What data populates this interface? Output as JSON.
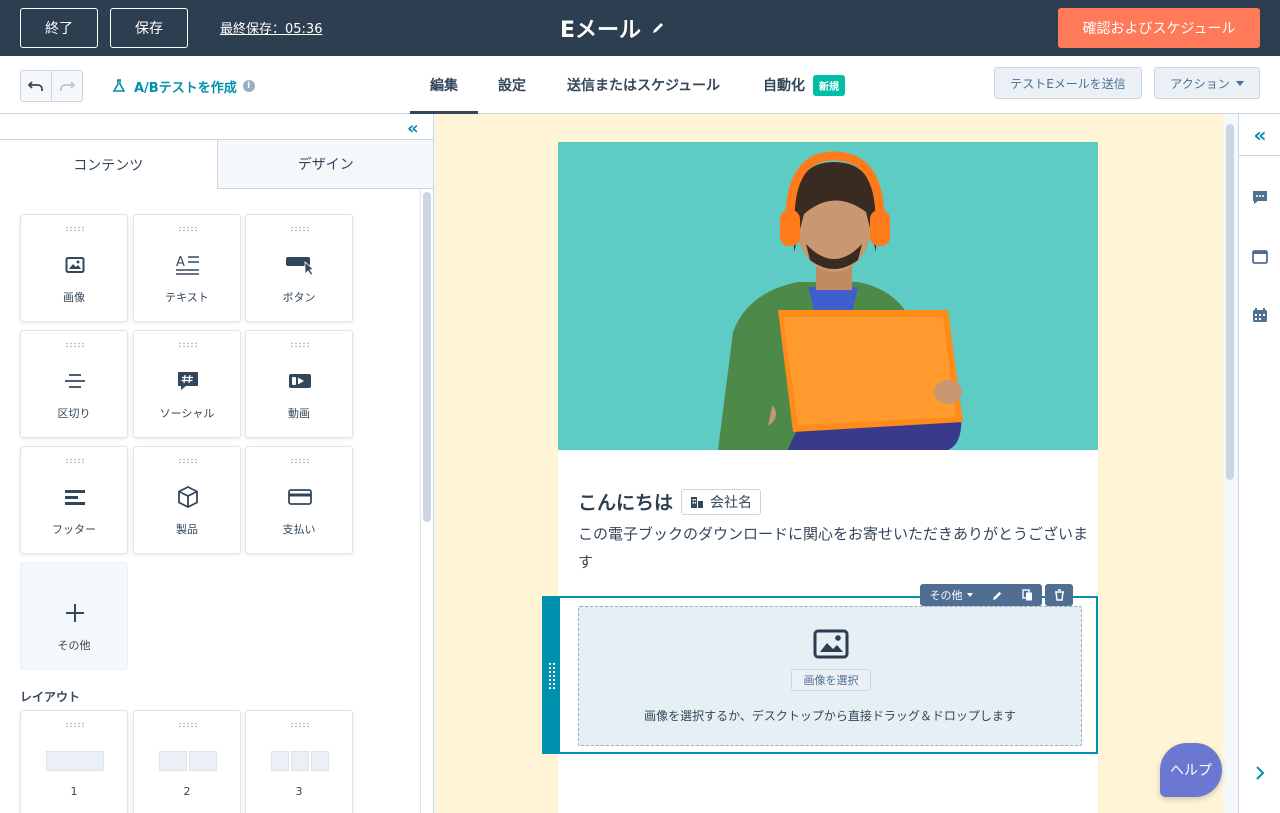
{
  "topbar": {
    "exit_label": "終了",
    "save_label": "保存",
    "last_saved": "最終保存：05:36",
    "title": "Eメール",
    "confirm_label": "確認およびスケジュール"
  },
  "subbar": {
    "ab_test_label": "A/Bテストを作成",
    "tabs": [
      {
        "label": "編集",
        "active": true
      },
      {
        "label": "設定"
      },
      {
        "label": "送信またはスケジュール"
      },
      {
        "label": "自動化",
        "badge": "新規"
      }
    ],
    "send_test_label": "テストEメールを送信",
    "actions_label": "アクション"
  },
  "leftpanel": {
    "tabs": [
      "コンテンツ",
      "デザイン"
    ],
    "modules": [
      {
        "label": "画像",
        "icon": "image-icon"
      },
      {
        "label": "テキスト",
        "icon": "text-icon"
      },
      {
        "label": "ボタン",
        "icon": "button-icon"
      },
      {
        "label": "区切り",
        "icon": "divider-icon"
      },
      {
        "label": "ソーシャル",
        "icon": "social-icon"
      },
      {
        "label": "動画",
        "icon": "video-icon"
      },
      {
        "label": "フッター",
        "icon": "footer-icon"
      },
      {
        "label": "製品",
        "icon": "product-icon"
      },
      {
        "label": "支払い",
        "icon": "payment-icon"
      },
      {
        "label": "その他",
        "icon": "plus-icon"
      }
    ],
    "layout_heading": "レイアウト",
    "layouts": [
      {
        "label": "1",
        "columns": 1
      },
      {
        "label": "2",
        "columns": 2
      },
      {
        "label": "3",
        "columns": 3
      }
    ]
  },
  "email": {
    "greeting": "こんにちは",
    "token_label": "会社名",
    "intro": "この電子ブックのダウンロードに関心をお寄せいただきありがとうございます",
    "module_toolbar": {
      "more_label": "その他"
    },
    "image_module": {
      "select_label": "画像を選択",
      "drop_text": "画像を選択するか、デスクトップから直接ドラッグ＆ドロップします"
    }
  },
  "help_label": "ヘルプ",
  "colors": {
    "topbar": "#2d3e50",
    "accent_orange": "#ff7a59",
    "teal": "#0091ae",
    "canvas_bg": "#fff4d6",
    "help": "#6a78d1"
  }
}
